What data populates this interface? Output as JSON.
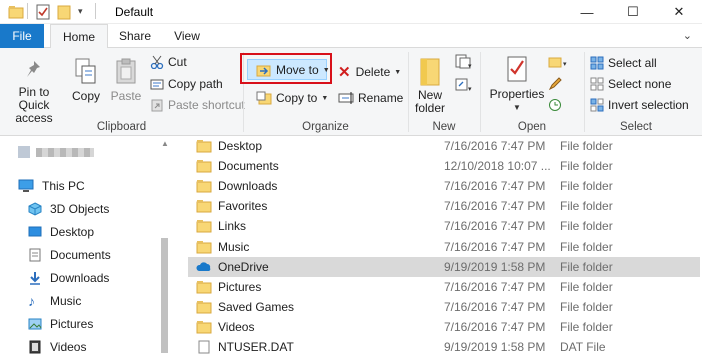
{
  "window": {
    "title": "Default",
    "minimize_glyph": "—",
    "maximize_glyph": "☐",
    "close_glyph": "✕"
  },
  "tabs": {
    "file": "File",
    "home": "Home",
    "share": "Share",
    "view": "View",
    "expand_glyph": "⌄"
  },
  "ribbon": {
    "clipboard": {
      "pin_line1": "Pin to Quick",
      "pin_line2": "access",
      "copy": "Copy",
      "paste": "Paste",
      "cut": "Cut",
      "copy_path": "Copy path",
      "paste_shortcut": "Paste shortcut",
      "label": "Clipboard"
    },
    "organize": {
      "move_to": "Move to",
      "delete": "Delete",
      "copy_to": "Copy to",
      "rename": "Rename",
      "label": "Organize"
    },
    "new": {
      "new_folder_line1": "New",
      "new_folder_line2": "folder",
      "label": "New"
    },
    "open": {
      "properties": "Properties",
      "label": "Open"
    },
    "select": {
      "select_all": "Select all",
      "select_none": "Select none",
      "invert_selection": "Invert selection",
      "label": "Select"
    }
  },
  "nav": {
    "items": [
      {
        "label": "This PC",
        "icon": "this-pc-icon"
      },
      {
        "label": "3D Objects",
        "icon": "3d-objects-icon"
      },
      {
        "label": "Desktop",
        "icon": "desktop-icon"
      },
      {
        "label": "Documents",
        "icon": "documents-icon"
      },
      {
        "label": "Downloads",
        "icon": "downloads-icon"
      },
      {
        "label": "Music",
        "icon": "music-icon"
      },
      {
        "label": "Pictures",
        "icon": "pictures-icon"
      },
      {
        "label": "Videos",
        "icon": "videos-icon"
      }
    ]
  },
  "files": [
    {
      "name": "Desktop",
      "date": "7/16/2016 7:47 PM",
      "type": "File folder",
      "icon": "folder-icon"
    },
    {
      "name": "Documents",
      "date": "12/10/2018 10:07 ...",
      "type": "File folder",
      "icon": "folder-icon"
    },
    {
      "name": "Downloads",
      "date": "7/16/2016 7:47 PM",
      "type": "File folder",
      "icon": "folder-icon"
    },
    {
      "name": "Favorites",
      "date": "7/16/2016 7:47 PM",
      "type": "File folder",
      "icon": "folder-icon"
    },
    {
      "name": "Links",
      "date": "7/16/2016 7:47 PM",
      "type": "File folder",
      "icon": "folder-icon"
    },
    {
      "name": "Music",
      "date": "7/16/2016 7:47 PM",
      "type": "File folder",
      "icon": "folder-icon"
    },
    {
      "name": "OneDrive",
      "date": "9/19/2019 1:58 PM",
      "type": "File folder",
      "icon": "onedrive-cloud-icon",
      "selected": true
    },
    {
      "name": "Pictures",
      "date": "7/16/2016 7:47 PM",
      "type": "File folder",
      "icon": "folder-icon"
    },
    {
      "name": "Saved Games",
      "date": "7/16/2016 7:47 PM",
      "type": "File folder",
      "icon": "folder-icon"
    },
    {
      "name": "Videos",
      "date": "7/16/2016 7:47 PM",
      "type": "File folder",
      "icon": "folder-icon"
    },
    {
      "name": "NTUSER.DAT",
      "date": "9/19/2019 1:58 PM",
      "type": "DAT File",
      "icon": "dat-file-icon"
    }
  ],
  "colors": {
    "file_tab": "#1979ca",
    "highlight_box": "#d8101a",
    "selected_row": "#d9d9d9",
    "folder": "#f8d775"
  }
}
